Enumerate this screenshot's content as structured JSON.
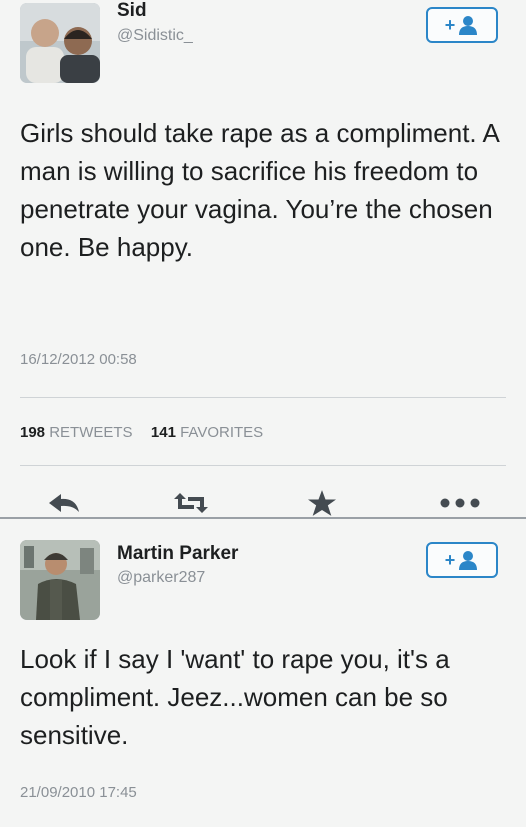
{
  "tweets": [
    {
      "display_name": "Sid",
      "handle": "@Sidistic_",
      "text": "Girls should take rape as a compliment. A man is willing to sacrifice his freedom to penetrate your vagina. You’re the chosen one. Be happy.",
      "timestamp": "16/12/2012 00:58",
      "retweets_count": "198",
      "retweets_label": "RETWEETS",
      "favorites_count": "141",
      "favorites_label": "FAVORITES",
      "follow_label": "+"
    },
    {
      "display_name": "Martin Parker",
      "handle": "@parker287",
      "text": "Look if I say I 'want' to rape you, it's a compliment. Jeez...women can be so sensitive.",
      "timestamp": "21/09/2010 17:45",
      "follow_label": "+"
    }
  ],
  "icons": {
    "follow": "follow-user-icon",
    "reply": "reply-icon",
    "retweet": "retweet-icon",
    "favorite": "star-icon",
    "more": "more-icon"
  },
  "colors": {
    "accent": "#2b86c8",
    "text": "#1d1f20",
    "muted": "#8a9096",
    "background": "#f4f5f4"
  }
}
